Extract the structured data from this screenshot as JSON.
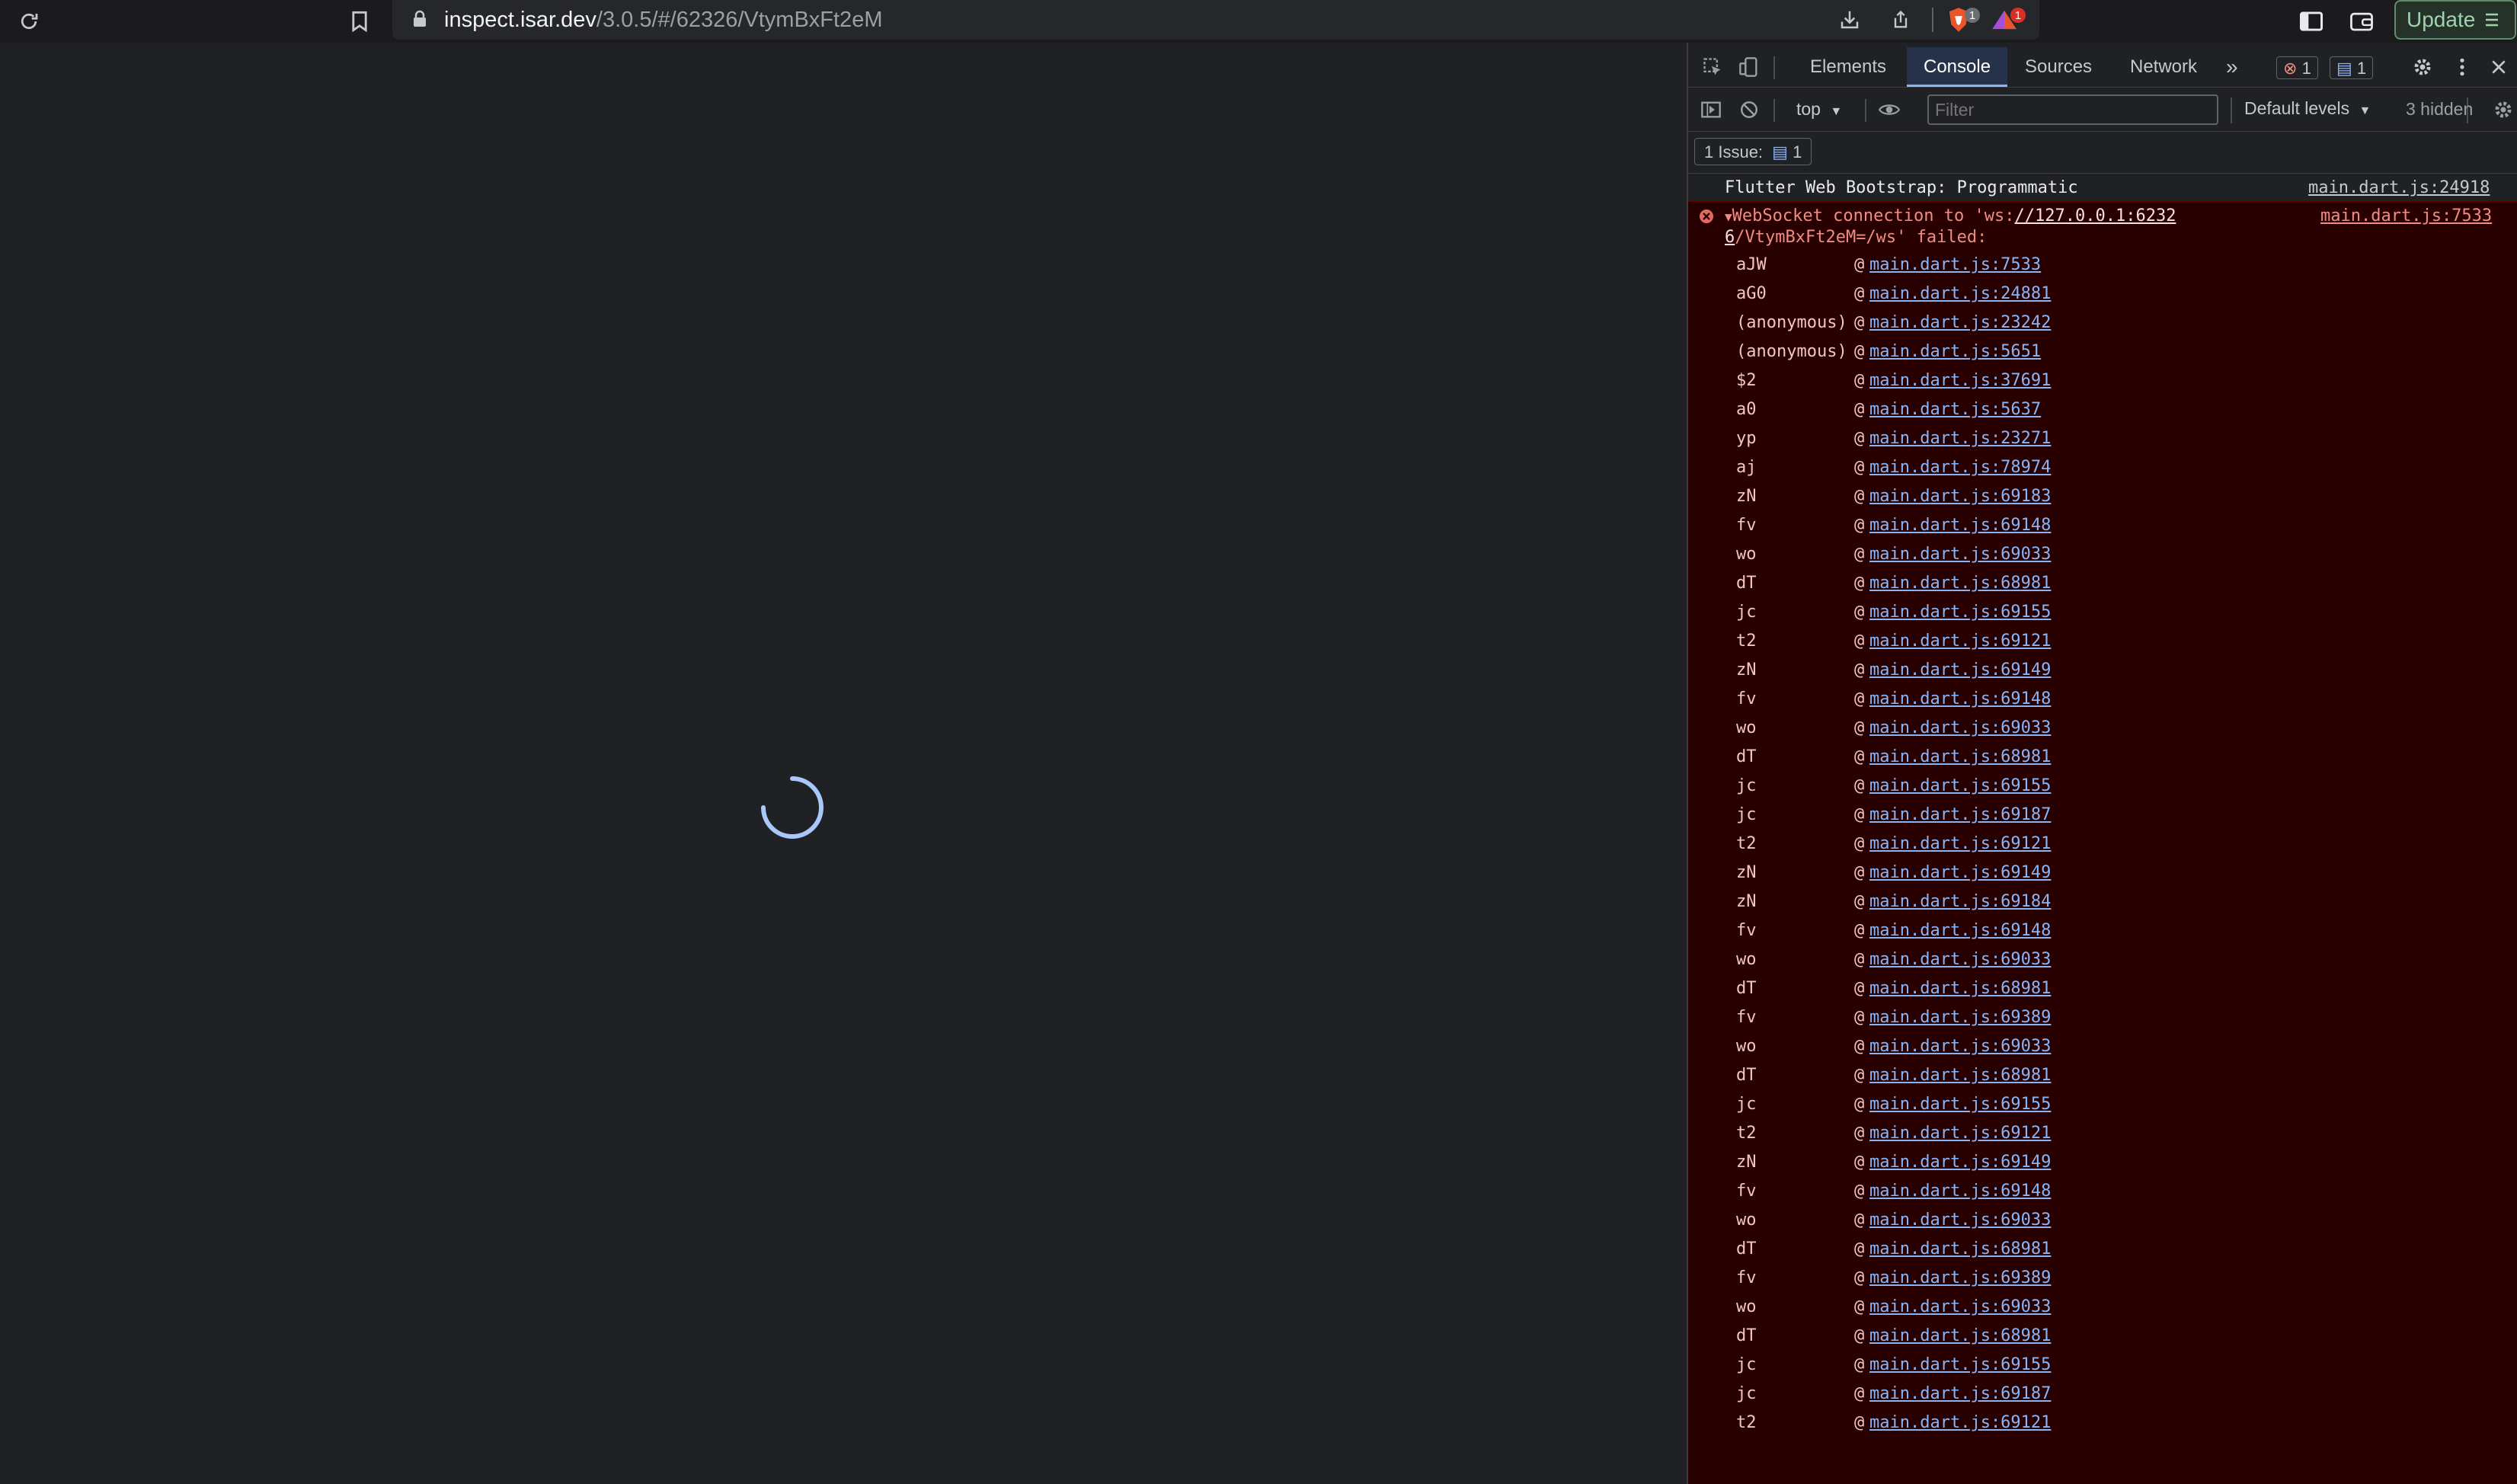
{
  "browser": {
    "url_host": "inspect.isar.dev",
    "url_path": "/3.0.5/#/62326/VtymBxFt2eM",
    "update_label": "Update",
    "shield_badge": "1",
    "alert_badge": "1"
  },
  "devtools": {
    "tabs": [
      "Elements",
      "Console",
      "Sources",
      "Network"
    ],
    "more_tabs": "»",
    "error_count": "1",
    "message_count": "1",
    "context": "top",
    "filter_placeholder": "Filter",
    "levels": "Default levels",
    "hidden": "3 hidden",
    "issues_label": "1 Issue:",
    "issues_count": "1"
  },
  "console": {
    "info_message": "Flutter Web Bootstrap: Programmatic",
    "info_source": "main.dart.js:24918",
    "error_line1_prefix": "WebSocket connection to 'ws:",
    "error_line1_link": "//127.0.0.1:6232",
    "error_line2_link": "6",
    "error_line2_rest": "/VtymBxFt2eM=/ws' failed:",
    "error_source": "main.dart.js:7533",
    "stack": [
      {
        "fn": "aJW",
        "loc": "main.dart.js:7533"
      },
      {
        "fn": "aG0",
        "loc": "main.dart.js:24881"
      },
      {
        "fn": "(anonymous)",
        "loc": "main.dart.js:23242"
      },
      {
        "fn": "(anonymous)",
        "loc": "main.dart.js:5651"
      },
      {
        "fn": "$2",
        "loc": "main.dart.js:37691"
      },
      {
        "fn": "a0",
        "loc": "main.dart.js:5637"
      },
      {
        "fn": "yp",
        "loc": "main.dart.js:23271"
      },
      {
        "fn": "aj",
        "loc": "main.dart.js:78974"
      },
      {
        "fn": "zN",
        "loc": "main.dart.js:69183"
      },
      {
        "fn": "fv",
        "loc": "main.dart.js:69148"
      },
      {
        "fn": "wo",
        "loc": "main.dart.js:69033"
      },
      {
        "fn": "dT",
        "loc": "main.dart.js:68981"
      },
      {
        "fn": "jc",
        "loc": "main.dart.js:69155"
      },
      {
        "fn": "t2",
        "loc": "main.dart.js:69121"
      },
      {
        "fn": "zN",
        "loc": "main.dart.js:69149"
      },
      {
        "fn": "fv",
        "loc": "main.dart.js:69148"
      },
      {
        "fn": "wo",
        "loc": "main.dart.js:69033"
      },
      {
        "fn": "dT",
        "loc": "main.dart.js:68981"
      },
      {
        "fn": "jc",
        "loc": "main.dart.js:69155"
      },
      {
        "fn": "jc",
        "loc": "main.dart.js:69187"
      },
      {
        "fn": "t2",
        "loc": "main.dart.js:69121"
      },
      {
        "fn": "zN",
        "loc": "main.dart.js:69149"
      },
      {
        "fn": "zN",
        "loc": "main.dart.js:69184"
      },
      {
        "fn": "fv",
        "loc": "main.dart.js:69148"
      },
      {
        "fn": "wo",
        "loc": "main.dart.js:69033"
      },
      {
        "fn": "dT",
        "loc": "main.dart.js:68981"
      },
      {
        "fn": "fv",
        "loc": "main.dart.js:69389"
      },
      {
        "fn": "wo",
        "loc": "main.dart.js:69033"
      },
      {
        "fn": "dT",
        "loc": "main.dart.js:68981"
      },
      {
        "fn": "jc",
        "loc": "main.dart.js:69155"
      },
      {
        "fn": "t2",
        "loc": "main.dart.js:69121"
      },
      {
        "fn": "zN",
        "loc": "main.dart.js:69149"
      },
      {
        "fn": "fv",
        "loc": "main.dart.js:69148"
      },
      {
        "fn": "wo",
        "loc": "main.dart.js:69033"
      },
      {
        "fn": "dT",
        "loc": "main.dart.js:68981"
      },
      {
        "fn": "fv",
        "loc": "main.dart.js:69389"
      },
      {
        "fn": "wo",
        "loc": "main.dart.js:69033"
      },
      {
        "fn": "dT",
        "loc": "main.dart.js:68981"
      },
      {
        "fn": "jc",
        "loc": "main.dart.js:69155"
      },
      {
        "fn": "jc",
        "loc": "main.dart.js:69187"
      },
      {
        "fn": "t2",
        "loc": "main.dart.js:69121"
      }
    ]
  }
}
